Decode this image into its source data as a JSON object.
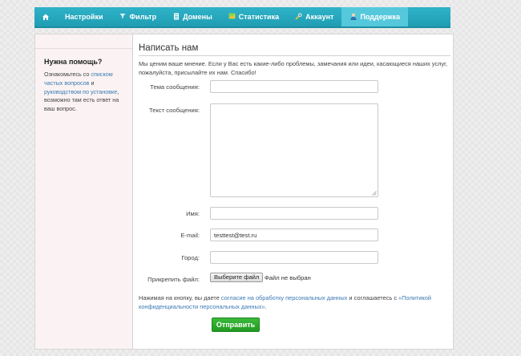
{
  "nav": {
    "home_icon": "home-icon",
    "items": [
      {
        "label": "Настройки",
        "icon": ""
      },
      {
        "label": "Фильтр",
        "icon": "filter-icon"
      },
      {
        "label": "Домены",
        "icon": "document-icon"
      },
      {
        "label": "Статистика",
        "icon": "chart-icon"
      },
      {
        "label": "Аккаунт",
        "icon": "wrench-icon"
      },
      {
        "label": "Поддержка",
        "icon": "user-icon",
        "active": true
      }
    ],
    "bar_color": "#22a5bb",
    "active_color": "#55c8dc"
  },
  "sidebar": {
    "title": "Нужна помощь?",
    "text_1": "Ознакомьтесь со ",
    "link_faq": "списком частых вопросов",
    "text_2": " и ",
    "link_guide": "руководством по установке",
    "text_3": ", возможно там есть ответ на ваш вопрос."
  },
  "main": {
    "title": "Написать нам",
    "intro": "Мы ценим ваше мнение. Если у Вас есть какие-либо проблемы, замечания или идеи, касающиеся наших услуг, пожалуйста, присылайте их нам. Спасибо!"
  },
  "form": {
    "subject_label": "Тема сообщения:",
    "subject_value": "",
    "message_label": "Текст сообщения:",
    "message_value": "",
    "name_label": "Имя:",
    "name_value": "",
    "email_label": "E-mail:",
    "email_value": "testtest@test.ru",
    "city_label": "Город:",
    "city_value": "",
    "attach_label": "Прикрепить файл:",
    "file_button": "Выберите файл",
    "file_status": "Файл не выбран"
  },
  "consent": {
    "text_1": "Нажимая на кнопку, вы даете ",
    "link_1": "согласие на обработку персональных данных",
    "text_2": " и соглашаетесь с ",
    "link_2": "«Политикой конфиденциальности персональных данных»",
    "text_3": "."
  },
  "submit_label": "Отправить",
  "colors": {
    "submit": "#2aa52a",
    "link": "#3a7ab5"
  }
}
